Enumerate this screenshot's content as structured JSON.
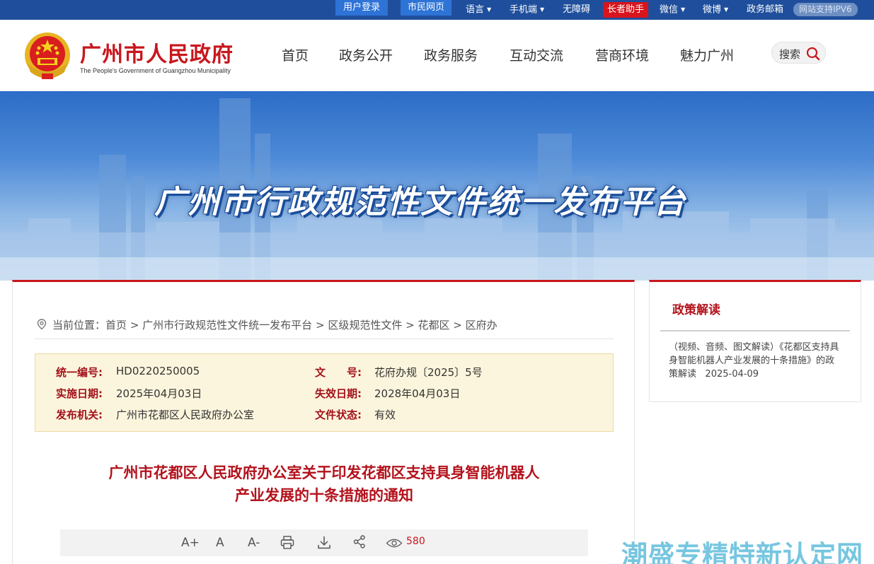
{
  "topbar": {
    "user_login": "用户登录",
    "citizen_page": "市民网页",
    "language": "语言",
    "mobile": "手机端",
    "accessibility": "无障碍",
    "elder_helper": "长者助手",
    "wechat": "微信",
    "weibo": "微博",
    "gov_mail": "政务邮箱",
    "ipv6": "网站支持IPV6"
  },
  "header": {
    "title": "广州市人民政府",
    "subtitle": "The People's Government of Guangzhou Municipality",
    "nav": [
      "首页",
      "政务公开",
      "政务服务",
      "互动交流",
      "营商环境",
      "魅力广州"
    ],
    "search_label": "搜索"
  },
  "banner": {
    "title": "广州市行政规范性文件统一发布平台"
  },
  "breadcrumb": {
    "prefix": "当前位置：",
    "items": [
      "首页",
      "广州市行政规范性文件统一发布平台",
      "区级规范性文件",
      "花都区",
      "区府办"
    ],
    "separator": ">"
  },
  "meta": {
    "id_label": "统一编号:",
    "id_value": "HD0220250005",
    "doc_no_label": "文　　号:",
    "doc_no_value": "花府办规〔2025〕5号",
    "effective_label": "实施日期:",
    "effective_value": "2025年04月03日",
    "expire_label": "失效日期:",
    "expire_value": "2028年04月03日",
    "issuer_label": "发布机关:",
    "issuer_value": "广州市花都区人民政府办公室",
    "status_label": "文件状态:",
    "status_value": "有效"
  },
  "document": {
    "title_line1": "广州市花都区人民政府办公室关于印发花都区支持具身智能机器人",
    "title_line2": "产业发展的十条措施的通知"
  },
  "toolbar": {
    "font_larger": "A+",
    "font_normal": "A",
    "font_smaller": "A-",
    "view_count": "580"
  },
  "side": {
    "title": "政策解读",
    "item_text": "（视频、音频、图文解读）《花都区支持具身智能机器人产业发展的十条措施》的政策解读",
    "item_date": "2025-04-09"
  },
  "watermark": "潮盛专精特新认定网",
  "colors": {
    "primary_red": "#c8161d",
    "top_bar_blue": "#1f4f9c",
    "meta_bg": "#fcf5dd"
  }
}
